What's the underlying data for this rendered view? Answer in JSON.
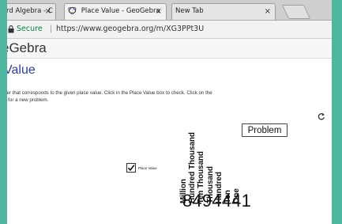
{
  "browser": {
    "tabs": [
      {
        "label": "rd Algebra - C",
        "active": false
      },
      {
        "label": "Place Value - GeoGebra",
        "active": true
      },
      {
        "label": "New Tab",
        "active": false
      }
    ],
    "close_glyph": "×",
    "secure_label": "Secure",
    "url": "https://www.geogebra.org/m/XG3PPt3U"
  },
  "header": {
    "logo_text": "eGebra"
  },
  "page": {
    "title": "Value",
    "instructions": [
      "ber that corresponds to the given place value.  Click in the Place Value box to check.  Click on the",
      "n for a new problem."
    ]
  },
  "applet": {
    "problem_button": "Problem",
    "place_value_checkbox": {
      "label": "Place Value",
      "checked": true
    },
    "places": [
      "Million",
      "Hundred Thousand",
      "Ten Thousand",
      "Thousand",
      "Hundred",
      "Ten",
      "One"
    ],
    "number": "8494441"
  },
  "colors": {
    "accent": "#2e3f8f",
    "secure": "#0b8043",
    "frame": "#4fb7a0"
  }
}
